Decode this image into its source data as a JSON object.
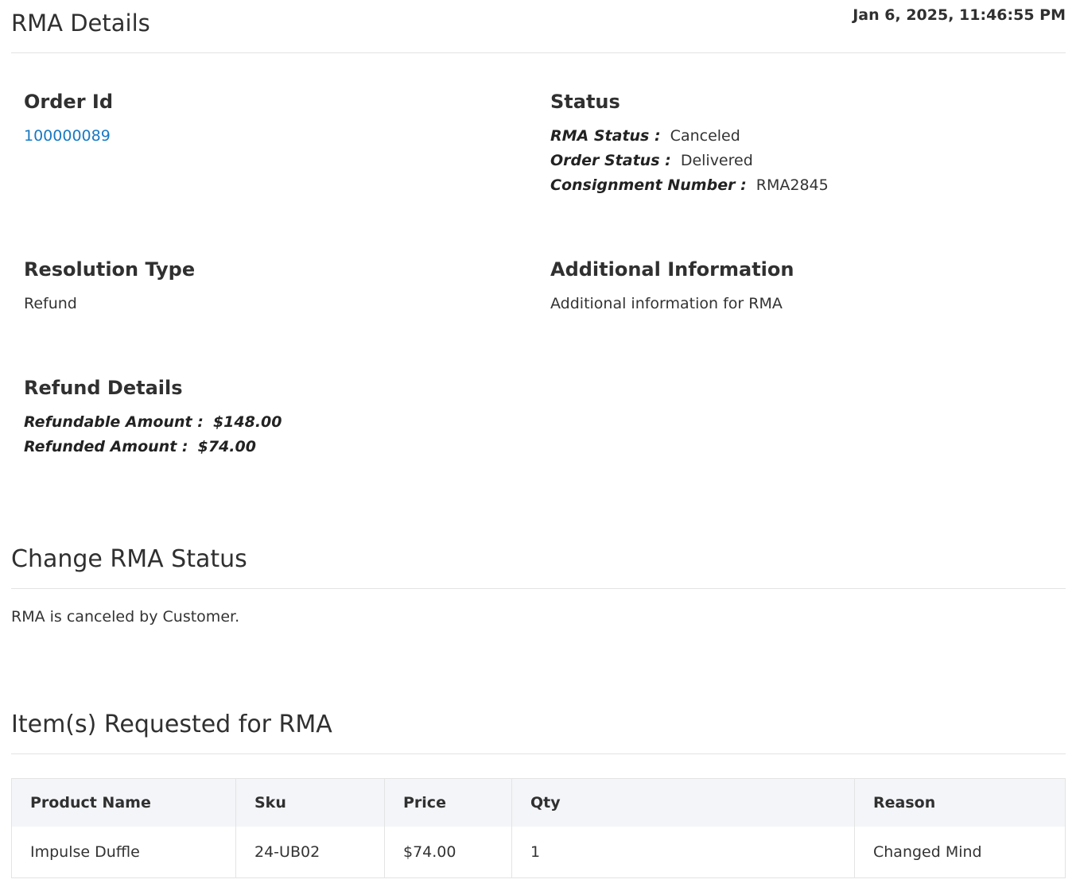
{
  "header": {
    "title": "RMA Details",
    "timestamp": "Jan 6, 2025, 11:46:55 PM"
  },
  "order": {
    "heading": "Order Id",
    "order_id": "100000089"
  },
  "status": {
    "heading": "Status",
    "rma_status_label": "RMA Status :",
    "rma_status_value": "Canceled",
    "order_status_label": "Order Status :",
    "order_status_value": "Delivered",
    "consignment_label": "Consignment Number :",
    "consignment_value": "RMA2845"
  },
  "resolution": {
    "heading": "Resolution Type",
    "value": "Refund"
  },
  "additional": {
    "heading": "Additional Information",
    "value": "Additional information for RMA"
  },
  "refund": {
    "heading": "Refund Details",
    "refundable_label": "Refundable Amount :",
    "refundable_value": "$148.00",
    "refunded_label": "Refunded Amount :",
    "refunded_value": "$74.00"
  },
  "change_status": {
    "heading": "Change RMA Status",
    "message": "RMA is canceled by Customer."
  },
  "items": {
    "heading": "Item(s) Requested for RMA",
    "columns": [
      "Product Name",
      "Sku",
      "Price",
      "Qty",
      "Reason"
    ],
    "rows": [
      {
        "product_name": "Impulse Duffle",
        "sku": "24-UB02",
        "price": "$74.00",
        "qty": "1",
        "reason": "Changed Mind"
      }
    ]
  }
}
